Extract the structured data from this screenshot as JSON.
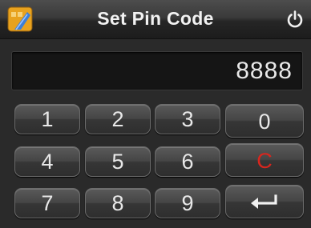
{
  "window": {
    "title": "Set Pin Code"
  },
  "display": {
    "value": "8888"
  },
  "keypad": {
    "k1": "1",
    "k2": "2",
    "k3": "3",
    "k4": "4",
    "k5": "5",
    "k6": "6",
    "k7": "7",
    "k8": "8",
    "k9": "9",
    "k0": "0",
    "clear": "C"
  },
  "icons": {
    "app": "pin-app-icon",
    "power": "power-icon",
    "enter": "enter-return-icon"
  },
  "colors": {
    "clear_accent": "#d8261e",
    "app_icon_orange": "#e8a21e",
    "app_icon_blue": "#3d7fd6"
  }
}
